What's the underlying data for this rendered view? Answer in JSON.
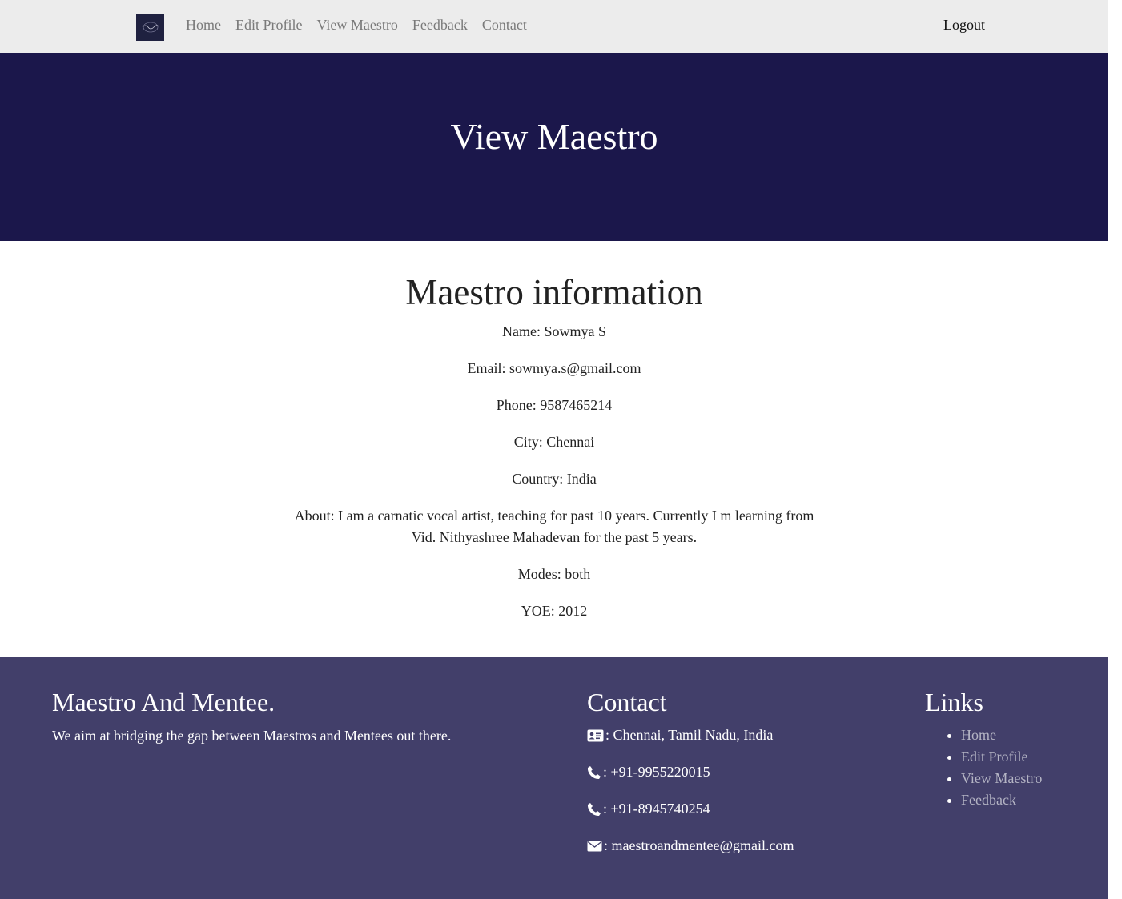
{
  "navbar": {
    "logo": "brand-logo-icon",
    "items": [
      {
        "label": "Home"
      },
      {
        "label": "Edit Profile"
      },
      {
        "label": "View Maestro"
      },
      {
        "label": "Feedback"
      },
      {
        "label": "Contact"
      }
    ],
    "logout_label": "Logout"
  },
  "hero": {
    "title": "View Maestro"
  },
  "info": {
    "heading": "Maestro information",
    "name": "Name: Sowmya S",
    "email": "Email: sowmya.s@gmail.com",
    "phone": "Phone: 9587465214",
    "city": "City: Chennai",
    "country": "Country: India",
    "about": "About: I am a carnatic vocal artist, teaching for past 10 years. Currently I m learning from Vid. Nithyashree Mahadevan for the past 5 years.",
    "modes": "Modes: both",
    "yoe": "YOE: 2012"
  },
  "footer": {
    "about": {
      "title": "Maestro And Mentee.",
      "text": "We aim at bridging the gap between Maestros and Mentees out there."
    },
    "contact": {
      "title": "Contact",
      "address": ": Chennai, Tamil Nadu, India",
      "phone1": ": +91-9955220015",
      "phone2": ": +91-8945740254",
      "email": ": maestroandmentee@gmail.com"
    },
    "links": {
      "title": "Links",
      "items": [
        {
          "label": "Home"
        },
        {
          "label": "Edit Profile"
        },
        {
          "label": "View Maestro"
        },
        {
          "label": "Feedback"
        }
      ]
    }
  },
  "colors": {
    "navbar_bg": "#ececec",
    "hero_bg": "#1b174b",
    "footer_bg": "#423f6a",
    "footer_link": "#b4b4c4"
  }
}
